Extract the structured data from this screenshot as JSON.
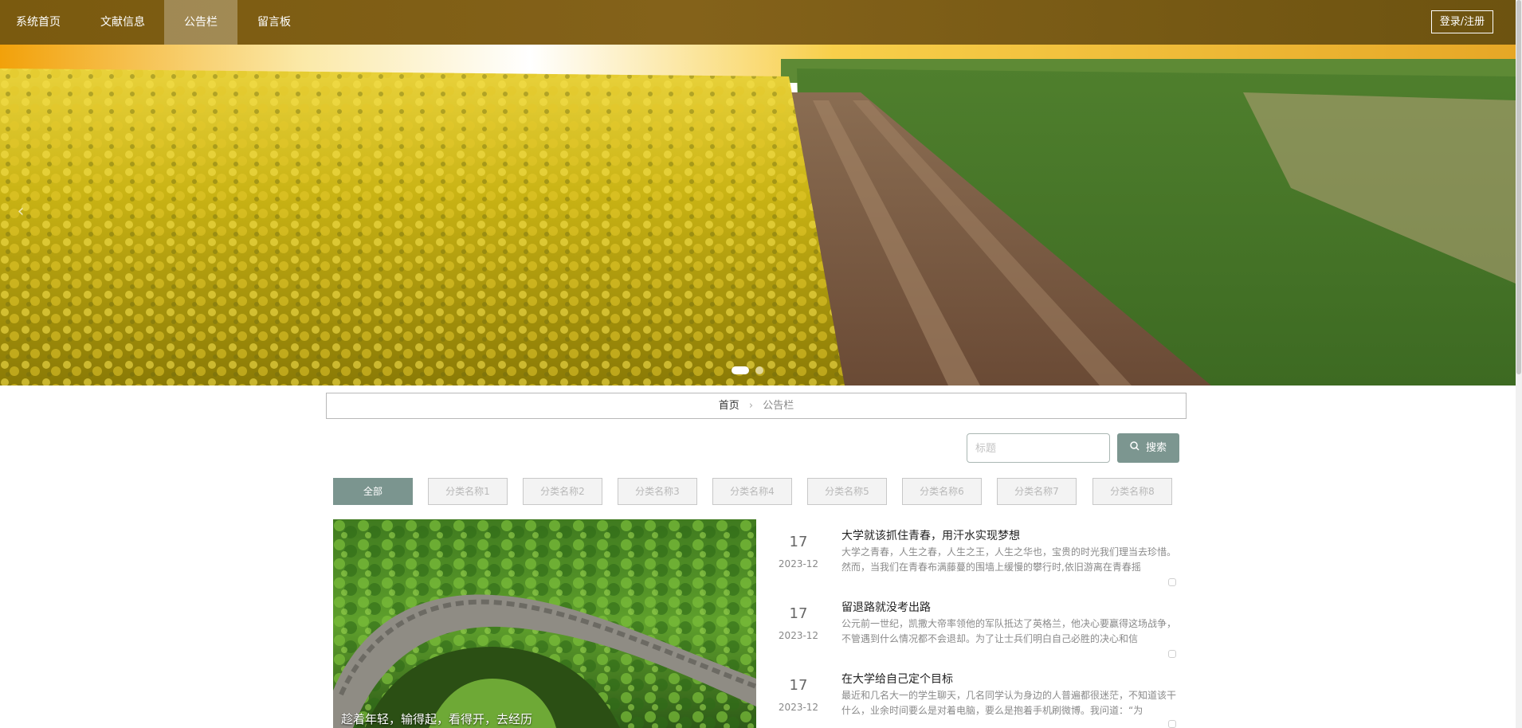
{
  "nav": {
    "items": [
      {
        "label": "系统首页",
        "active": false
      },
      {
        "label": "文献信息",
        "active": false
      },
      {
        "label": "公告栏",
        "active": true
      },
      {
        "label": "留言板",
        "active": false
      }
    ],
    "login_label": "登录/注册"
  },
  "banner": {
    "slides": 2,
    "active_slide": 1,
    "prev_icon": "chevron-left-icon"
  },
  "breadcrumb": {
    "home": "首页",
    "separator": "›",
    "current": "公告栏"
  },
  "search": {
    "placeholder": "标题",
    "value": "",
    "button_label": "搜索",
    "icon": "search-icon"
  },
  "categories": {
    "items": [
      "全部",
      "分类名称1",
      "分类名称2",
      "分类名称3",
      "分类名称4",
      "分类名称5",
      "分类名称6",
      "分类名称7",
      "分类名称8"
    ],
    "active_index": 0
  },
  "featured": {
    "caption": "趁着年轻，输得起，看得开，去经历"
  },
  "news": [
    {
      "day": "17",
      "date": "2023-12",
      "title": "大学就该抓住青春，用汗水实现梦想",
      "summary": "大学之青春，人生之春，人生之王，人生之华也，宝贵的时光我们理当去珍惜。然而，当我们在青春布满藤蔓的围墙上缓慢的攀行时,依旧游离在青春摇"
    },
    {
      "day": "17",
      "date": "2023-12",
      "title": "留退路就没考出路",
      "summary": "公元前一世纪，凯撒大帝率领他的军队抵达了英格兰，他决心要赢得这场战争，不管遇到什么情况都不会退却。为了让士兵们明白自己必胜的决心和信"
    },
    {
      "day": "17",
      "date": "2023-12",
      "title": "在大学给自己定个目标",
      "summary": "最近和几名大一的学生聊天，几名同学认为身边的人普遍都很迷茫，不知道该干什么，业余时间要么是对着电脑，要么是抱着手机刷微博。我问道：“为"
    }
  ],
  "colors": {
    "nav_bg": "#7a5a0f",
    "accent": "#7b958f"
  }
}
